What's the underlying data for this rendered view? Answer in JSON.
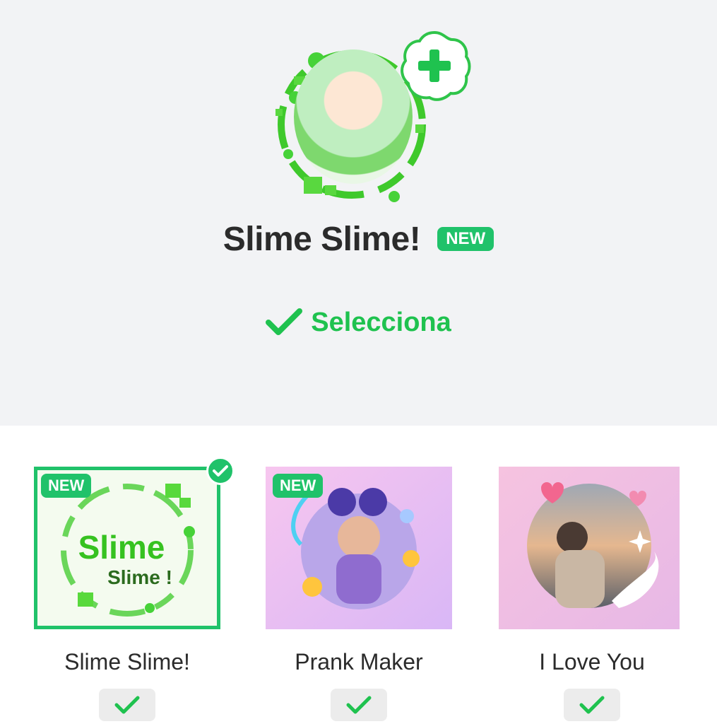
{
  "header": {
    "frame_title": "Slime Slime!",
    "new_badge": "NEW",
    "select_label": "Selecciona",
    "icons": {
      "add": "plus-icon",
      "select": "checkmark-icon"
    }
  },
  "colors": {
    "accent_green": "#1fc24f",
    "badge_green": "#20c26a",
    "top_bg": "#f2f3f5"
  },
  "frames": [
    {
      "name": "Slime Slime!",
      "badge": "NEW",
      "selected": true,
      "thumb_text_1": "Slime",
      "thumb_text_2": "Slime !"
    },
    {
      "name": "Prank Maker",
      "badge": "NEW",
      "selected": false
    },
    {
      "name": "I Love You",
      "badge": "",
      "selected": false
    }
  ]
}
